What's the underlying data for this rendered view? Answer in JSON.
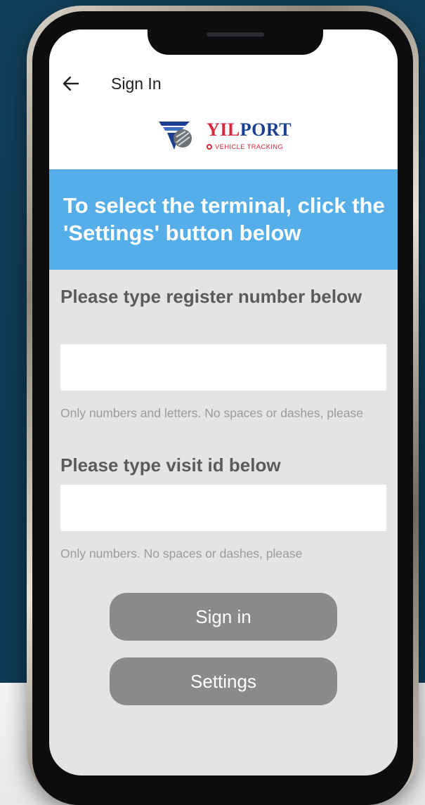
{
  "app_bar": {
    "back_icon": "arrow-left-icon",
    "title": "Sign In"
  },
  "logo": {
    "icon": "yilport-emblem-icon",
    "name_part1": "YIL",
    "name_part2": "PORT",
    "subtitle": "VEHICLE TRACKING"
  },
  "banner": {
    "text": "To select the terminal, click the 'Settings' button below"
  },
  "form": {
    "register": {
      "label": "Please type register number below",
      "value": "",
      "placeholder": "",
      "hint": "Only numbers and letters. No spaces or dashes, please"
    },
    "visit": {
      "label": "Please type visit id below",
      "value": "",
      "placeholder": "",
      "hint": "Only numbers. No spaces or dashes, please"
    }
  },
  "buttons": {
    "sign_in": "Sign in",
    "settings": "Settings"
  },
  "colors": {
    "banner": "#56aee8",
    "button": "#8a8a8a",
    "screen_bg": "#e4e4e4",
    "brand_blue": "#1d3f8f",
    "brand_red": "#d7263d",
    "backdrop": "#123f5a"
  }
}
